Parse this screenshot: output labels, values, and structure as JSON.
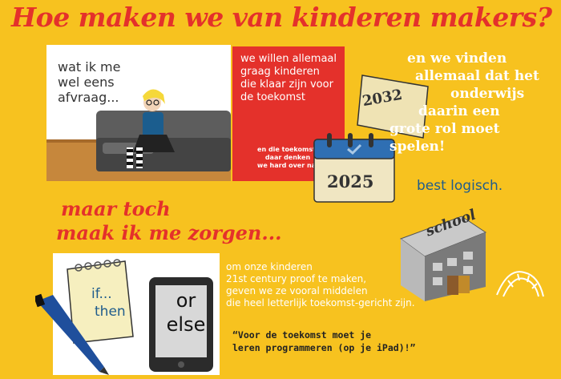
{
  "title": "Hoe maken we van kinderen makers?",
  "panel1": {
    "text_lines": [
      "wat ik me",
      "wel eens",
      "afvraag..."
    ]
  },
  "red_card": {
    "main_lines": [
      "we willen allemaal",
      "graag kinderen",
      "die klaar zijn voor",
      "de toekomst"
    ],
    "sub_lines": [
      "en die toekomst,",
      "daar denken",
      "we hard over na."
    ]
  },
  "calendar": {
    "year_top": "2032",
    "year_bottom": "2025"
  },
  "right_text_lines": [
    "en we vinden",
    "allemaal dat het",
    "onderwijs",
    "daarin een",
    "grote rol moet",
    "spelen!"
  ],
  "best_logisch": "best logisch.",
  "maar_lines": [
    "maar toch",
    "maak ik me zorgen..."
  ],
  "school_sign": "school",
  "notepad_lines": [
    "if...",
    "then"
  ],
  "tablet_lines": [
    "or",
    "else"
  ],
  "onze_lines": [
    "om onze kinderen",
    "21st century proof te maken,",
    "geven we ze vooral middelen",
    "die heel letterlijk toekomst-gericht zijn."
  ],
  "quote_lines": [
    "“Voor de toekomst moet je",
    "leren programmeren (op je iPad)!”"
  ],
  "colors": {
    "background": "#f7c21f",
    "accent_red": "#e4312b",
    "white": "#ffffff",
    "blue": "#1f5c8c"
  }
}
